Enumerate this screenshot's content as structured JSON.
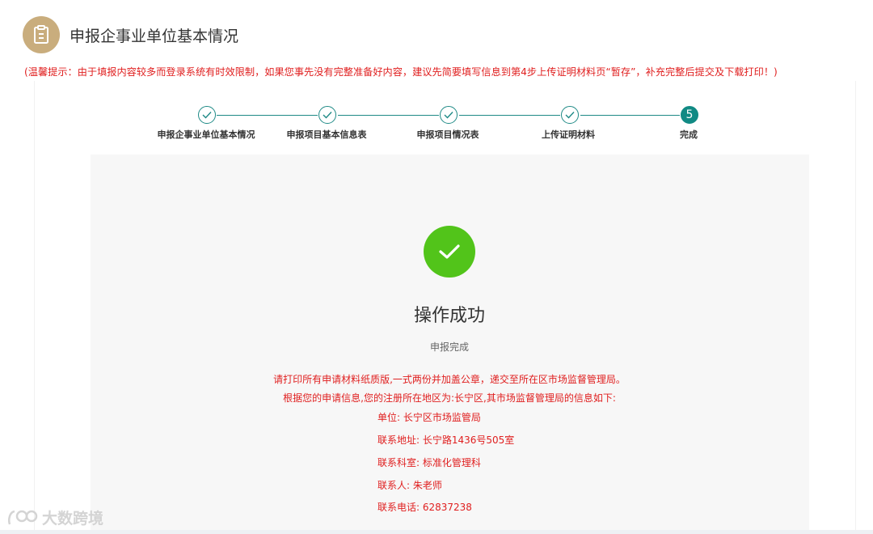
{
  "header": {
    "title": "申报企事业单位基本情况",
    "icon": "clipboard-icon",
    "icon_bg": "#c9ad7d"
  },
  "notice": "(温馨提示：由于填报内容较多而登录系统有时效限制，如果您事先没有完整准备好内容，建议先简要填写信息到第4步上传证明材料页“暂存”，补充完整后提交及下载打印！)",
  "stepper": {
    "accent": "#118a84",
    "steps": [
      {
        "label": "申报企事业单位基本情况",
        "status": "done"
      },
      {
        "label": "申报项目基本信息表",
        "status": "done"
      },
      {
        "label": "申报项目情况表",
        "status": "done"
      },
      {
        "label": "上传证明材料",
        "status": "done"
      },
      {
        "label": "完成",
        "status": "active",
        "number": "5"
      }
    ]
  },
  "result": {
    "icon": "check-icon",
    "icon_color": "#52c41a",
    "title": "操作成功",
    "subtitle": "申报完成",
    "instruction_1": "请打印所有申请材料纸质版,一式两份并加盖公章，递交至所在区市场监督管理局。",
    "instruction_2": "根据您的申请信息,您的注册所在地区为:长宁区,其市场监督管理局的信息如下:",
    "info": {
      "unit": "单位:  长宁区市场监管局",
      "address": "联系地址:  长宁路1436号505室",
      "department": "联系科室:  标准化管理科",
      "contact": "联系人:  朱老师",
      "phone": "联系电话:  62837238"
    },
    "text_color": "#e02020"
  },
  "watermark": {
    "text": "大数跨境",
    "logo_text": "LOGO"
  }
}
